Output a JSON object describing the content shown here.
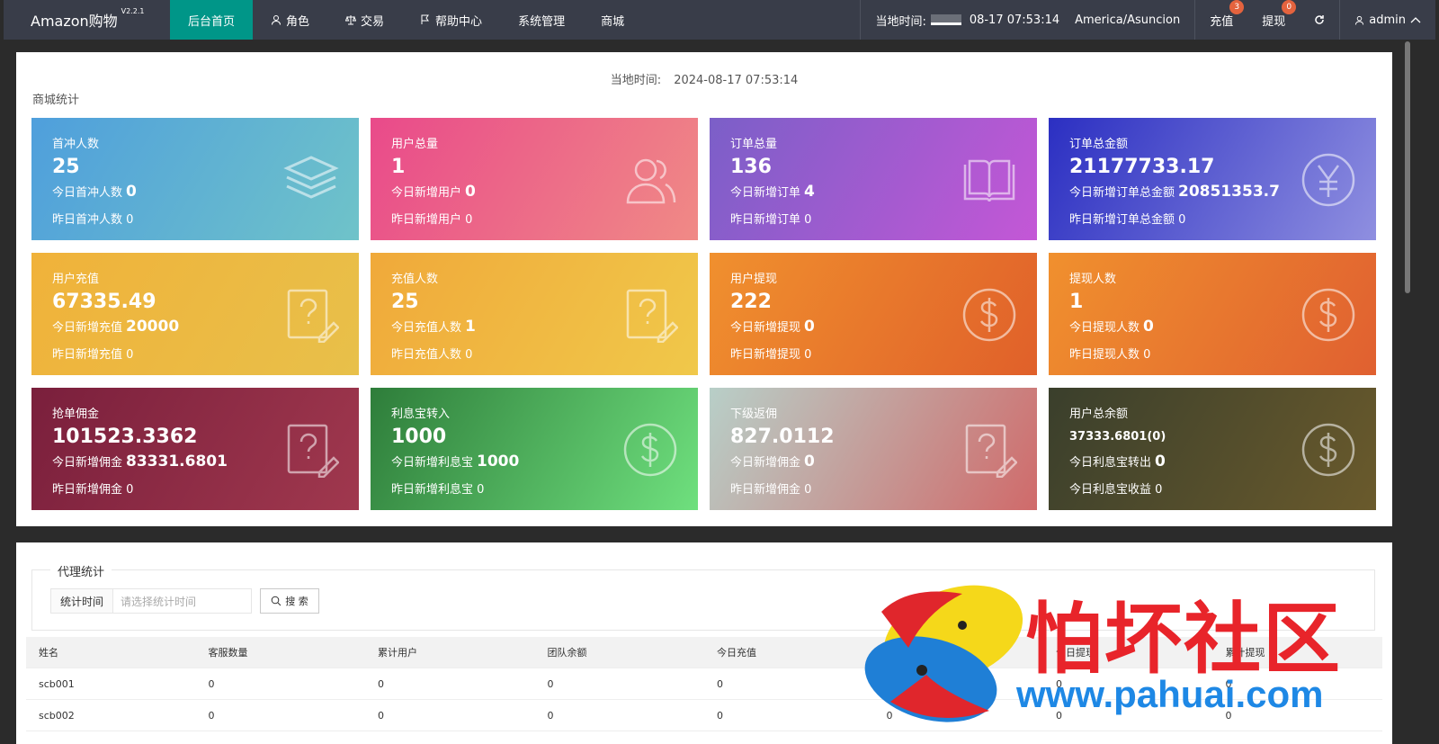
{
  "brand": {
    "name": "Amazon购物",
    "version": "V2.2.1"
  },
  "nav": [
    {
      "label": "后台首页",
      "icon": ""
    },
    {
      "label": "角色",
      "icon": "user-icon"
    },
    {
      "label": "交易",
      "icon": "scale-icon"
    },
    {
      "label": "帮助中心",
      "icon": "flag-icon"
    },
    {
      "label": "系统管理",
      "icon": ""
    },
    {
      "label": "商城",
      "icon": ""
    }
  ],
  "topright": {
    "time_label": "当地时间:",
    "time_value": "08-17 07:53:14",
    "timezone": "America/Asuncion",
    "recharge_label": "充值",
    "recharge_badge": "3",
    "withdraw_label": "提现",
    "withdraw_badge": "0",
    "user": "admin"
  },
  "stats": {
    "local_time_label": "当地时间:",
    "local_time_value": "2024-08-17 07:53:14",
    "section_title": "商城统计",
    "cards": [
      {
        "title": "首冲人数",
        "value": "25",
        "today_label": "今日首冲人数",
        "today_value": "0",
        "yesterday": "昨日首冲人数 0",
        "icon": "layers-icon"
      },
      {
        "title": "用户总量",
        "value": "1",
        "today_label": "今日新增用户",
        "today_value": "0",
        "yesterday": "昨日新增用户 0",
        "icon": "users-icon"
      },
      {
        "title": "订单总量",
        "value": "136",
        "today_label": "今日新增订单",
        "today_value": "4",
        "yesterday": "昨日新增订单 0",
        "icon": "book-icon"
      },
      {
        "title": "订单总金额",
        "value": "21177733.17",
        "today_label": "今日新增订单总金额",
        "today_value": "20851353.7",
        "yesterday": "昨日新增订单总金额 0",
        "icon": "yen-icon"
      },
      {
        "title": "用户充值",
        "value": "67335.49",
        "today_label": "今日新增充值",
        "today_value": "20000",
        "yesterday": "昨日新增充值 0",
        "icon": "question-edit-icon"
      },
      {
        "title": "充值人数",
        "value": "25",
        "today_label": "今日充值人数",
        "today_value": "1",
        "yesterday": "昨日充值人数 0",
        "icon": "question-edit-icon"
      },
      {
        "title": "用户提现",
        "value": "222",
        "today_label": "今日新增提现",
        "today_value": "0",
        "yesterday": "昨日新增提现 0",
        "icon": "dollar-icon"
      },
      {
        "title": "提现人数",
        "value": "1",
        "today_label": "今日提现人数",
        "today_value": "0",
        "yesterday": "昨日提现人数 0",
        "icon": "dollar-icon"
      },
      {
        "title": "抢单佣金",
        "value": "101523.3362",
        "today_label": "今日新增佣金",
        "today_value": "83331.6801",
        "yesterday": "昨日新增佣金 0",
        "icon": "question-edit-icon"
      },
      {
        "title": "利息宝转入",
        "value": "1000",
        "today_label": "今日新增利息宝",
        "today_value": "1000",
        "yesterday": "昨日新增利息宝 0",
        "icon": "dollar-icon"
      },
      {
        "title": "下级返佣",
        "value": "827.0112",
        "today_label": "今日新增佣金",
        "today_value": "0",
        "yesterday": "昨日新增佣金 0",
        "icon": "question-edit-icon"
      },
      {
        "title": "用户总余额",
        "value": "37333.6801(0)",
        "today_label": "今日利息宝转出",
        "today_value": "0",
        "yesterday": "今日利息宝收益 0",
        "icon": "dollar-icon"
      }
    ],
    "card_gradients": [
      [
        "#4f9fdc",
        "#6fc3c9"
      ],
      [
        "#e94a8a",
        "#f08a86"
      ],
      [
        "#7b5fc8",
        "#c457d6"
      ],
      [
        "#2b2fc2",
        "#8f8fe0"
      ],
      [
        "#f0b23a",
        "#e8c04a"
      ],
      [
        "#f0a93a",
        "#f0c84a"
      ],
      [
        "#f0902e",
        "#e0602a"
      ],
      [
        "#f0902e",
        "#e06030"
      ],
      [
        "#7a1f3c",
        "#a0384e"
      ],
      [
        "#2e7d3a",
        "#6fe07e"
      ],
      [
        "#b8cfc8",
        "#d06a6a"
      ],
      [
        "#3a3f2c",
        "#6a5a2c"
      ]
    ]
  },
  "agent": {
    "legend": "代理统计",
    "filter_label": "统计时间",
    "filter_placeholder": "请选择统计时间",
    "search_label": "搜 索",
    "columns": [
      "姓名",
      "客服数量",
      "累计用户",
      "团队余额",
      "今日充值",
      "累计充值",
      "今日提现",
      "累计提现"
    ],
    "rows": [
      [
        "scb001",
        "0",
        "0",
        "0",
        "0",
        "0",
        "0",
        "0"
      ],
      [
        "scb002",
        "0",
        "0",
        "0",
        "0",
        "0",
        "0",
        "0"
      ]
    ]
  },
  "watermark": {
    "text": "怕坏社区",
    "url": "www.pahuai.com"
  }
}
